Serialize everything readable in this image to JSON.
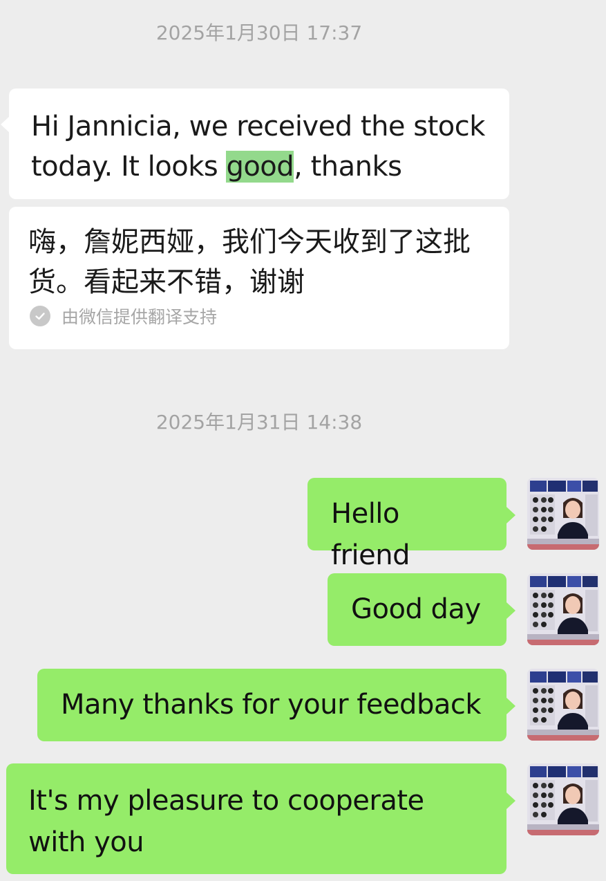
{
  "timestamps": {
    "first": "2025年1月30日 17:37",
    "second": "2025年1月31日 14:38"
  },
  "incoming": {
    "message_part1": "Hi Jannicia, we received the stock today. It looks ",
    "message_highlight": "good",
    "message_part2": ", thanks",
    "translation_text": "嗨，詹妮西娅，我们今天收到了这批货。看起来不错，谢谢",
    "translation_source": "由微信提供翻译支持",
    "translation_icon": "check-circle-icon"
  },
  "outgoing": [
    {
      "text": "Hello friend"
    },
    {
      "text": "Good day"
    },
    {
      "text": "Many thanks for your feedback"
    },
    {
      "text": "It's my pleasure to cooperate with you"
    }
  ],
  "colors": {
    "background": "#ededed",
    "incoming_bubble": "#ffffff",
    "outgoing_bubble": "#95ec69",
    "highlight": "#93d98c",
    "timestamp_text": "#a3a3a3"
  }
}
